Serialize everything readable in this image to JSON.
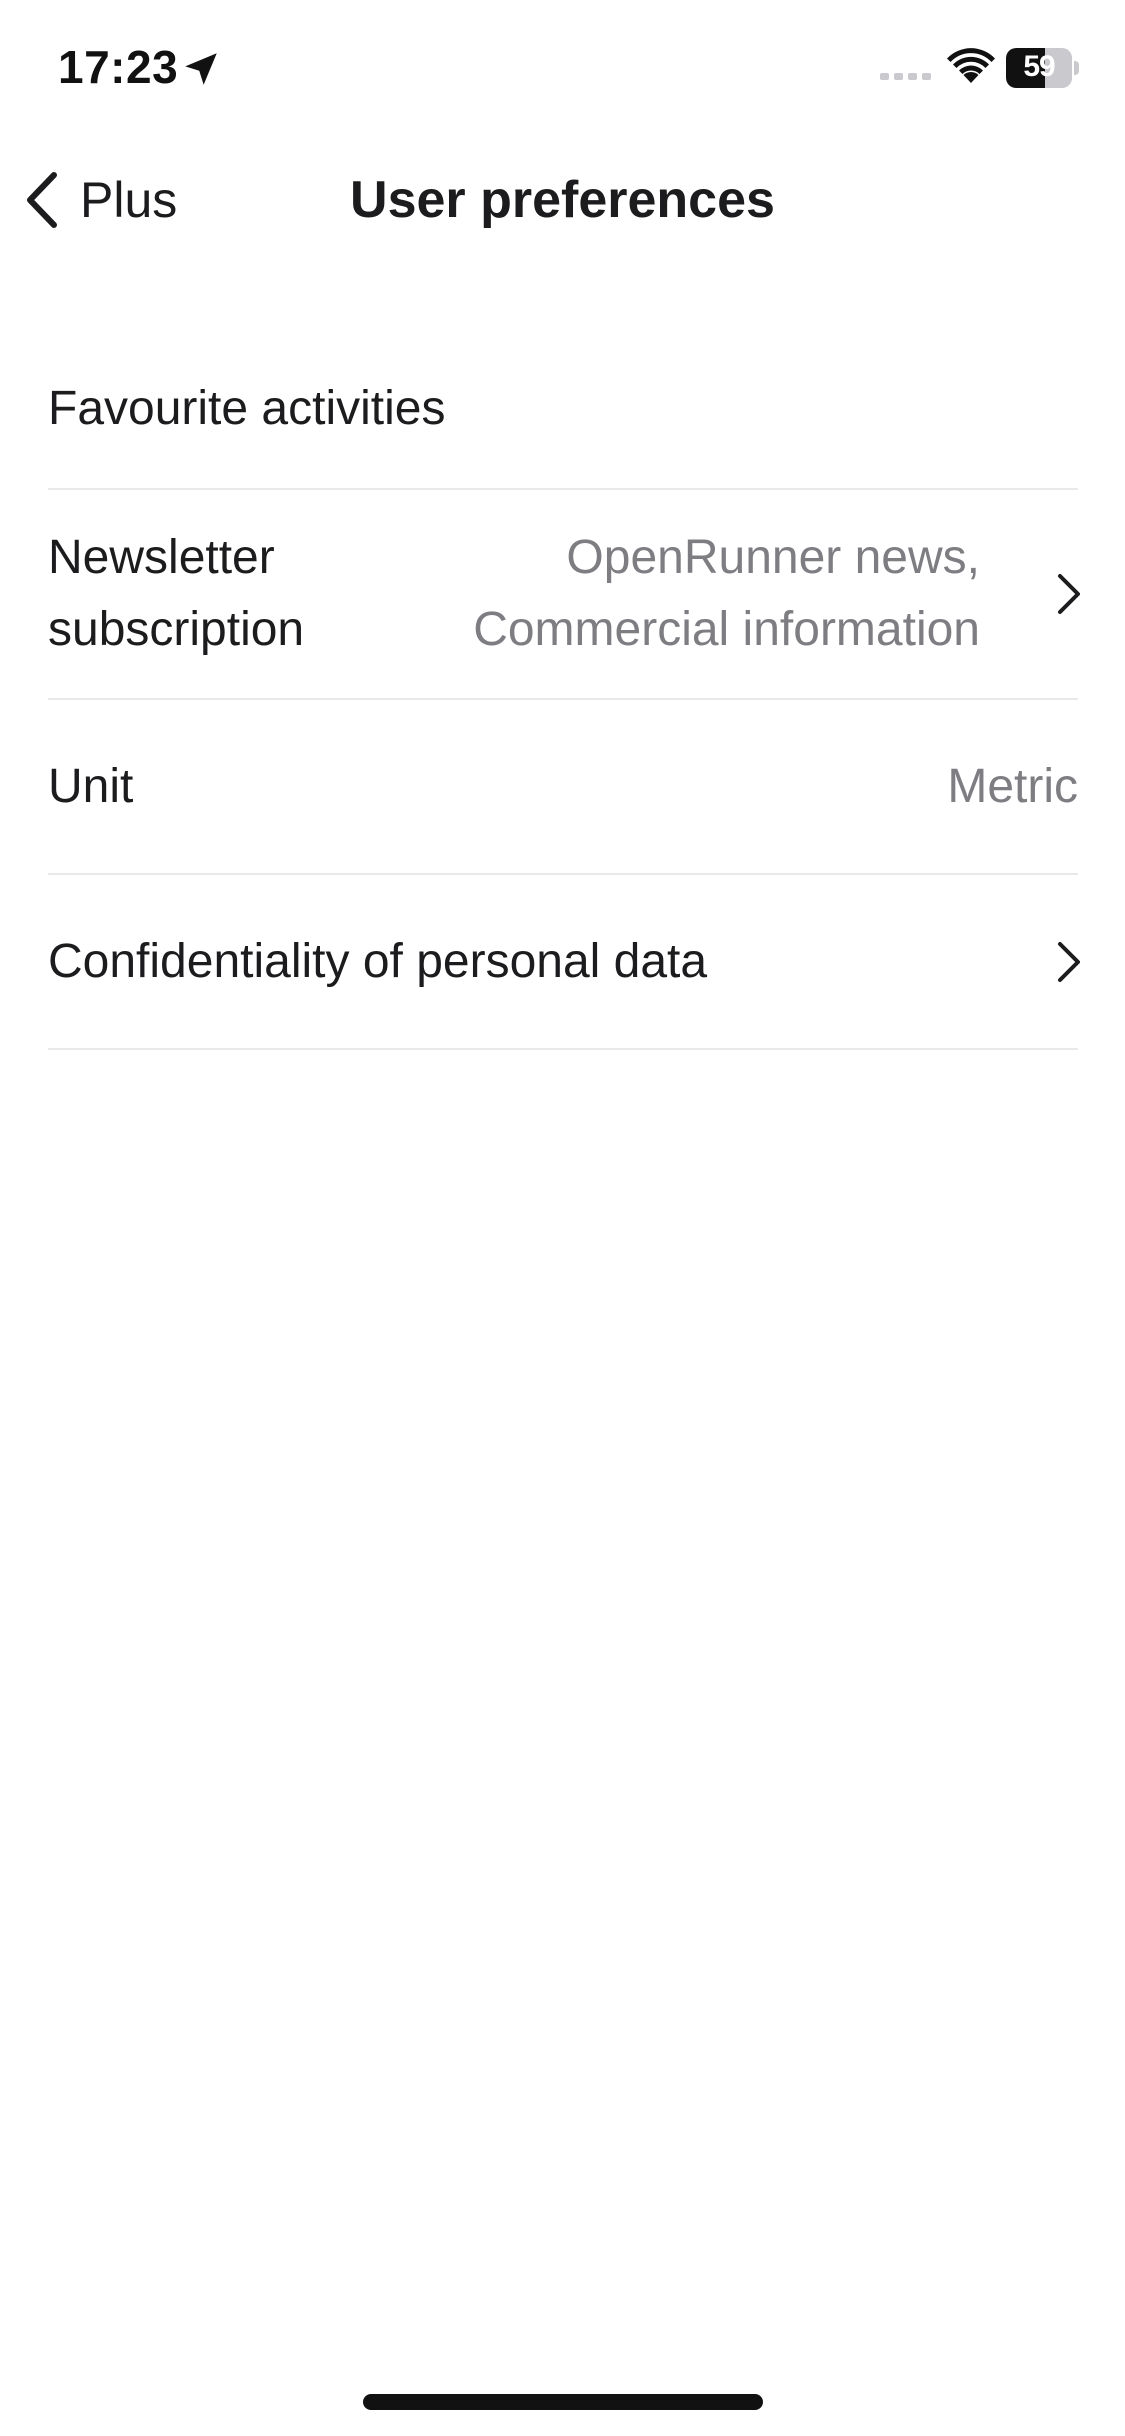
{
  "status_bar": {
    "time": "17:23",
    "battery_level": "59",
    "icons": [
      "location-arrow-icon",
      "cellular-signal-icon",
      "wifi-icon",
      "battery-icon"
    ]
  },
  "nav": {
    "back_label": "Plus",
    "title": "User preferences"
  },
  "settings": {
    "items": [
      {
        "label": "Favourite activities",
        "value": "",
        "has_chevron": false
      },
      {
        "label": "Newsletter subscription",
        "value": "OpenRunner news, Commercial information",
        "has_chevron": true
      },
      {
        "label": "Unit",
        "value": "Metric",
        "has_chevron": false
      },
      {
        "label": "Confidentiality of personal data",
        "value": "",
        "has_chevron": true
      }
    ]
  },
  "colors": {
    "text_primary": "#1c1c1e",
    "text_secondary": "#7d7d82",
    "separator": "#e9e9ec",
    "background": "#ffffff"
  }
}
